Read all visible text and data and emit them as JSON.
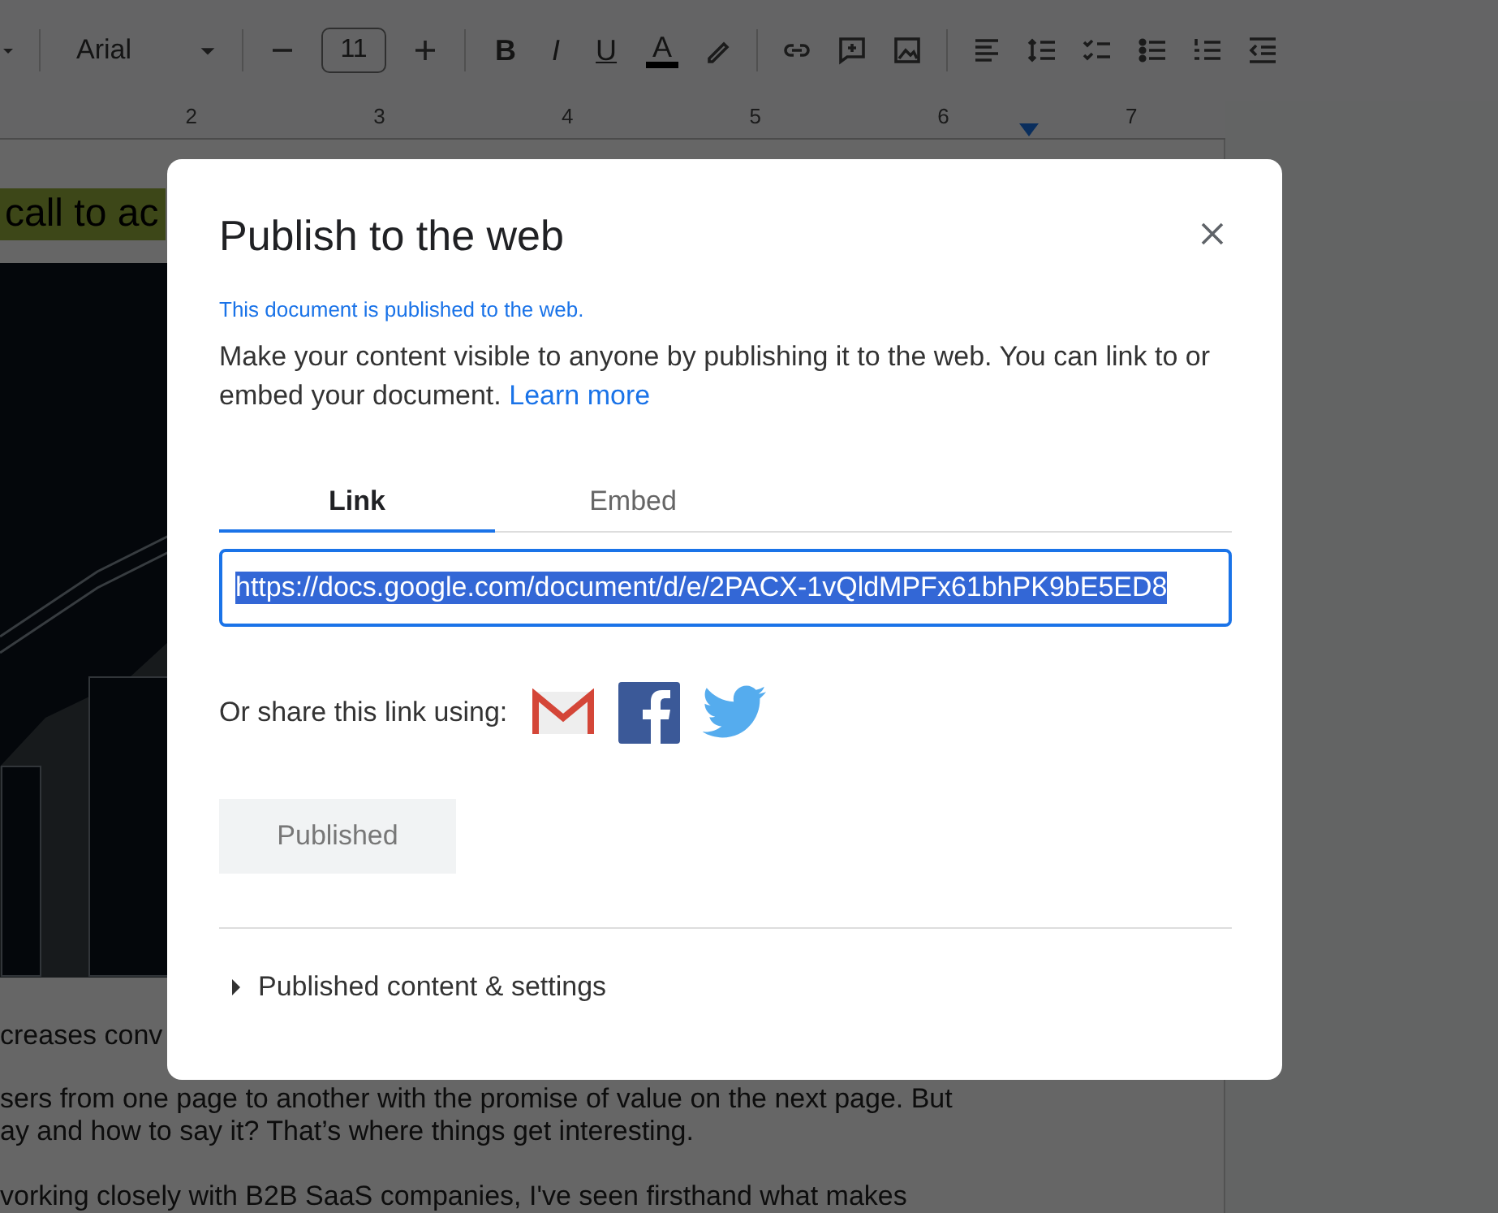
{
  "toolbar": {
    "font": "Arial",
    "font_size": "11",
    "format_buttons": [
      "B",
      "I",
      "U",
      "A"
    ]
  },
  "ruler": {
    "marks": [
      "2",
      "3",
      "4",
      "5",
      "6",
      "7"
    ]
  },
  "document": {
    "heading": "call to ac",
    "lines": [
      "creases conv",
      "sers from one page to another with the promise of value on the next page. But",
      "ay and how to say it? That’s where things get interesting.",
      "vorking closely with B2B SaaS companies, I've seen firsthand what makes"
    ]
  },
  "dialog": {
    "title": "Publish to the web",
    "status": "This document is published to the web.",
    "description": "Make your content visible to anyone by publishing it to the web. You can link to or embed your document.",
    "learn_more": "Learn more",
    "tabs": [
      {
        "label": "Link",
        "selected": true
      },
      {
        "label": "Embed",
        "selected": false
      }
    ],
    "url": "https://docs.google.com/document/d/e/2PACX-1vQldMPFx61bhPK9bE5ED8",
    "share_label": "Or share this link using:",
    "publish_button": {
      "label": "Published",
      "disabled": true
    },
    "settings": {
      "label": "Published content & settings",
      "expanded": false
    }
  }
}
